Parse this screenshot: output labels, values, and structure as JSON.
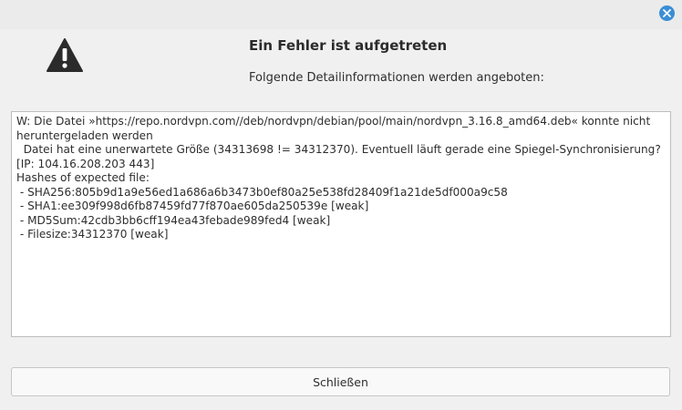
{
  "dialog": {
    "title": "Ein Fehler ist aufgetreten",
    "subtitle": "Folgende Detailinformationen werden angeboten:",
    "warning_icon": "warning-triangle",
    "close_icon": "close-x"
  },
  "details": {
    "lines": [
      "W: Die Datei »https://repo.nordvpn.com//deb/nordvpn/debian/pool/main/nordvpn_3.16.8_amd64.deb« konnte nicht heruntergeladen werden",
      "  Datei hat eine unerwartete Größe (34313698 != 34312370). Eventuell läuft gerade eine Spiegel-Synchronisierung? [IP: 104.16.208.203 443]",
      "Hashes of expected file:",
      " - SHA256:805b9d1a9e56ed1a686a6b3473b0ef80a25e538fd28409f1a21de5df000a9c58",
      " - SHA1:ee309f998d6fb87459fd77f870ae605da250539e [weak]",
      " - MD5Sum:42cdb3bb6cff194ea43febade989fed4 [weak]",
      " - Filesize:34312370 [weak]"
    ]
  },
  "buttons": {
    "close_label": "Schließen"
  },
  "colors": {
    "accent": "#3b8ed6",
    "background": "#f0f0f0",
    "text": "#2e2e2e"
  }
}
